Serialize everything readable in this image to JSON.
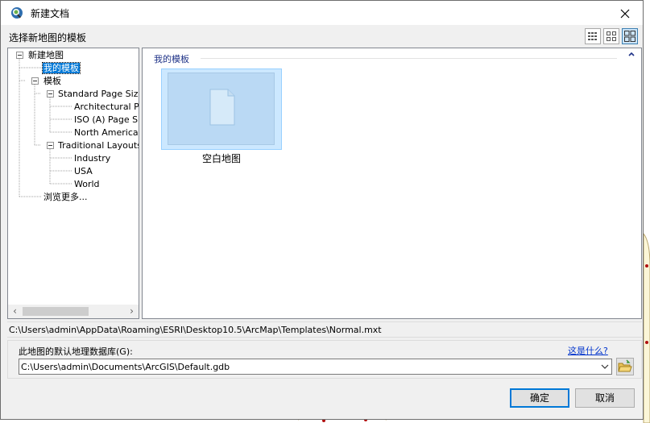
{
  "window": {
    "title": "新建文档"
  },
  "header": {
    "label": "选择新地图的模板"
  },
  "view_modes": [
    "details-view-icon",
    "medium-icons-view-icon",
    "large-icons-view-icon"
  ],
  "tree": {
    "nodes": [
      {
        "label": "新建地图"
      },
      {
        "label": "我的模板",
        "selected": true
      },
      {
        "label": "模板"
      },
      {
        "label": "Standard Page Sizes"
      },
      {
        "label": "Architectural Pag"
      },
      {
        "label": "ISO (A) Page Siz"
      },
      {
        "label": "North American ("
      },
      {
        "label": "Traditional Layouts"
      },
      {
        "label": "Industry"
      },
      {
        "label": "USA"
      },
      {
        "label": "World"
      },
      {
        "label": "浏览更多..."
      }
    ]
  },
  "content": {
    "group_label": "我的模板",
    "tiles": [
      {
        "label": "空白地图"
      }
    ]
  },
  "path": "C:\\Users\\admin\\AppData\\Roaming\\ESRI\\Desktop10.5\\ArcMap\\Templates\\Normal.mxt",
  "gdb": {
    "label": "此地图的默认地理数据库(G):",
    "help_link": "这是什么?",
    "value": "C:\\Users\\admin\\Documents\\ArcGIS\\Default.gdb"
  },
  "buttons": {
    "ok": "确定",
    "cancel": "取消"
  },
  "colors": {
    "selection": "#0078d7",
    "tile_bg": "#cce8ff",
    "link": "#0033cc",
    "group_header": "#1e3287"
  }
}
